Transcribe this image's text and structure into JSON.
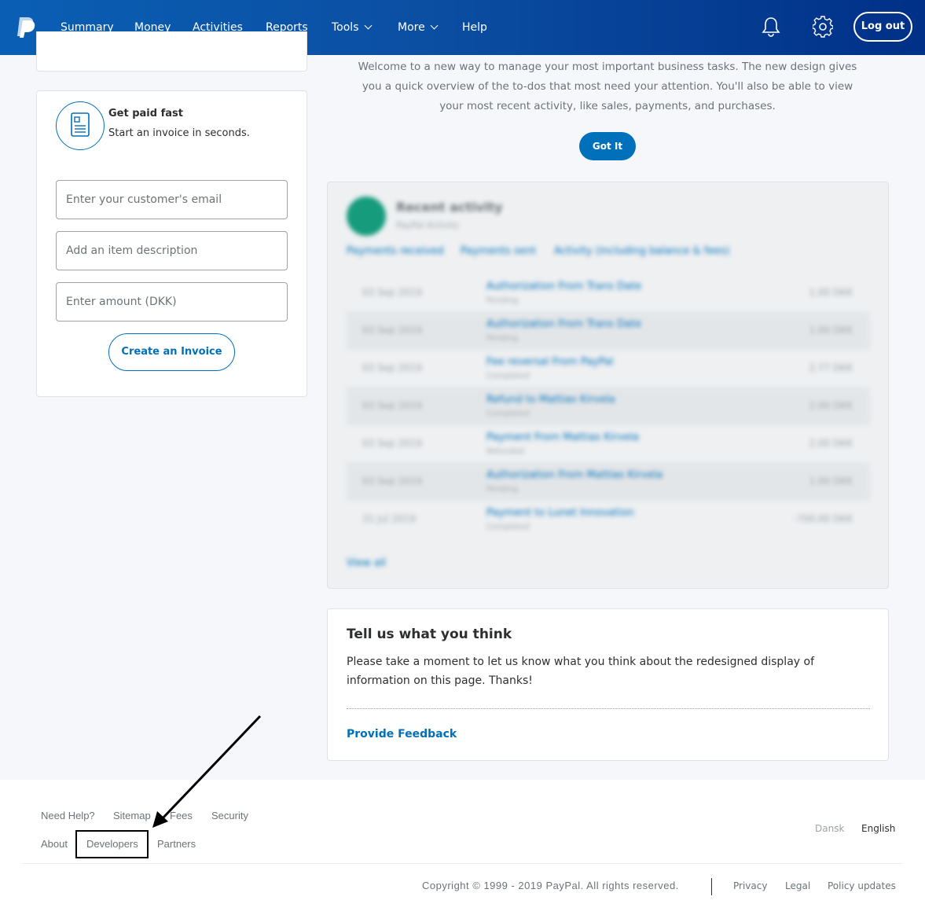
{
  "header": {
    "nav": [
      {
        "label": "Summary",
        "active": true
      },
      {
        "label": "Money"
      },
      {
        "label": "Activities"
      },
      {
        "label": "Reports"
      },
      {
        "label": "Tools",
        "dropdown": true
      },
      {
        "label": "More",
        "dropdown": true
      },
      {
        "label": "Help"
      }
    ],
    "icons": [
      "paypal-logo-icon",
      "bell-icon",
      "gear-icon"
    ],
    "logout_label": "Log out"
  },
  "invoice": {
    "title": "Get paid fast",
    "subtitle": "Start an invoice in seconds.",
    "email_placeholder": "Enter your customer's email",
    "item_placeholder": "Add an item description",
    "amount_placeholder": "Enter amount (DKK)",
    "create_label": "Create an Invoice"
  },
  "welcome": {
    "text": "Welcome to a new way to manage your most important business tasks. The new design gives you a quick overview of the to-dos that most need your attention. You'll also be able to view your most recent activity, like sales, payments, and purchases.",
    "button_label": "Got It"
  },
  "activity": {
    "title": "Recent activity",
    "subtitle": "PayPal Activity",
    "tabs": [
      "Payments received",
      "Payments sent",
      "Activity (including balance & fees)"
    ],
    "rows": [
      {
        "date": "03 Sep 2019",
        "desc": "Authorization From Trans Date",
        "status": "Pending",
        "amount": "1.00 DKK"
      },
      {
        "date": "03 Sep 2019",
        "desc": "Authorization From Trans Date",
        "status": "Pending",
        "amount": "1.00 DKK"
      },
      {
        "date": "03 Sep 2019",
        "desc": "Fee reversal From PayPal",
        "status": "Completed",
        "amount": "2.77 DKK"
      },
      {
        "date": "03 Sep 2019",
        "desc": "Refund to Mattias Kirvela",
        "status": "Completed",
        "amount": "2.00 DKK"
      },
      {
        "date": "03 Sep 2019",
        "desc": "Payment From Mattias Kirvela",
        "status": "Refunded",
        "amount": "2.00 DKK"
      },
      {
        "date": "03 Sep 2019",
        "desc": "Authorization From Mattias Kirvela",
        "status": "Pending",
        "amount": "1.00 DKK"
      },
      {
        "date": "31 Jul 2019",
        "desc": "Payment to Lunet Innovation",
        "status": "Completed",
        "amount": "-700,00 DKK"
      }
    ],
    "view_all": "View all"
  },
  "feedback": {
    "title": "Tell us what you think",
    "text": "Please take a moment to let us know what you think about the redesigned display of information on this page. Thanks!",
    "link": "Provide Feedback"
  },
  "footer": {
    "row1": [
      "Need Help?",
      "Sitemap",
      "Fees",
      "Security"
    ],
    "row2": [
      "About",
      "Developers",
      "Partners"
    ],
    "languages": [
      {
        "label": "Dansk",
        "active": false
      },
      {
        "label": "English",
        "active": true
      }
    ],
    "copyright": "Copyright © 1999 - 2019 PayPal. All rights reserved.",
    "legal": [
      "Privacy",
      "Legal",
      "Policy updates"
    ]
  },
  "colors": {
    "brand_blue": "#0070ba",
    "header_dark": "#003087",
    "activity_green": "#169b7d"
  }
}
